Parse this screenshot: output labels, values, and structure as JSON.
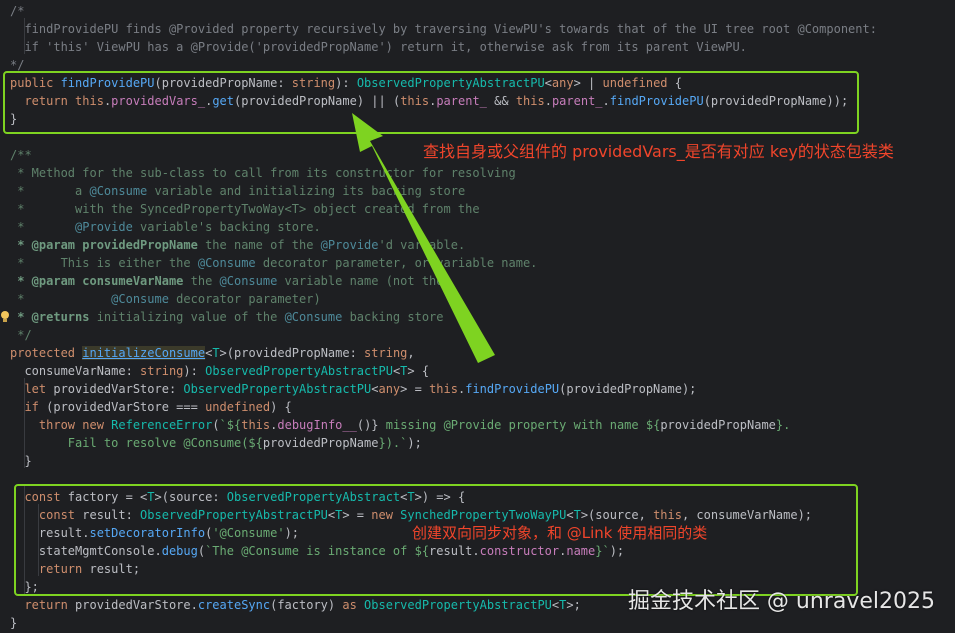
{
  "code": {
    "l1": "/*",
    "l2": "  findProvidePU finds @Provided property recursively by traversing ViewPU's towards that of the UI tree root @Component:",
    "l3": "  if 'this' ViewPU has a @Provide('providedPropName') return it, otherwise ask from its parent ViewPU.",
    "l4": "*/",
    "l5_kw": "public ",
    "l5_fn": "findProvidePU",
    "l5_a": "(providedPropName: ",
    "l5_kw2": "string",
    "l5_b": "): ",
    "l5_type": "ObservedPropertyAbstractPU",
    "l5_c": "<",
    "l5_kw3": "any",
    "l5_d": "> | ",
    "l5_kw4": "undefined",
    "l5_e": " {",
    "l6_kw": "  return ",
    "l6_kw2": "this",
    "l6_a": ".",
    "l6_prop": "providedVars_",
    "l6_b": ".",
    "l6_fn": "get",
    "l6_c": "(providedPropName) || (",
    "l6_kw3": "this",
    "l6_d": ".",
    "l6_prop2": "parent_",
    "l6_e": " && ",
    "l6_kw4": "this",
    "l6_f": ".",
    "l6_prop3": "parent_",
    "l6_g": ".",
    "l6_fn2": "findProvidePU",
    "l6_h": "(providedPropName));",
    "l7": "}",
    "l8": "/**",
    "l9": " * Method for the sub-class to call from its constructor for resolving",
    "l10_a": " *       a ",
    "l10_ref": "@Consume",
    "l10_b": " variable and initializing its backing store",
    "l11": " *       with the SyncedPropertyTwoWay<T> object created from the",
    "l12_a": " *       ",
    "l12_ref": "@Provide",
    "l12_b": " variable's backing store.",
    "l13_tag": " * @param ",
    "l13_p": "providedPropName",
    "l13_a": " the name of the ",
    "l13_ref": "@Provide",
    "l13_b": "'d variable.",
    "l14_a": " *     This is either the ",
    "l14_ref": "@Consume",
    "l14_b": " decorator parameter, or variable name.",
    "l15_tag": " * @param ",
    "l15_p": "consumeVarName",
    "l15_a": " the ",
    "l15_ref": "@Consume",
    "l15_b": " variable name (not the",
    "l16_a": " *            ",
    "l16_ref": "@Consume",
    "l16_b": " decorator parameter)",
    "l17_tag": " * @returns",
    "l17_a": " initializing value of the ",
    "l17_ref": "@Consume",
    "l17_b": " backing store",
    "l18": " */",
    "l19_kw": "protected ",
    "l19_fn": "initializeConsume",
    "l19_a": "<",
    "l19_type": "T",
    "l19_b": ">(providedPropName: ",
    "l19_kw2": "string",
    "l19_c": ",",
    "l20_a": "  consumeVarName: ",
    "l20_kw": "string",
    "l20_b": "): ",
    "l20_type": "ObservedPropertyAbstractPU",
    "l20_c": "<",
    "l20_type2": "T",
    "l20_d": "> {",
    "l21_kw": "  let ",
    "l21_a": "providedVarStore: ",
    "l21_type": "ObservedPropertyAbstractPU",
    "l21_b": "<",
    "l21_kw2": "any",
    "l21_c": "> = ",
    "l21_kw3": "this",
    "l21_d": ".",
    "l21_fn": "findProvidePU",
    "l21_e": "(providedPropName);",
    "l22_kw": "  if ",
    "l22_a": "(providedVarStore === ",
    "l22_kw2": "undefined",
    "l22_b": ") {",
    "l23_kw": "    throw new ",
    "l23_type": "ReferenceError",
    "l23_a": "(",
    "l23_str": "`${",
    "l23_kw2": "this",
    "l23_b": ".",
    "l23_prop": "debugInfo__",
    "l23_c": "()}",
    "l23_str2": " missing @Provide property with name ${",
    "l23_d": "providedPropName",
    "l23_str3": "}.",
    "l24_str": "        Fail to resolve @Consume(${",
    "l24_a": "providedPropName",
    "l24_str2": "}).`",
    "l24_b": ");",
    "l25": "  }",
    "l26_kw": "  const ",
    "l26_a": "factory = <",
    "l26_type": "T",
    "l26_b": ">(source: ",
    "l26_type2": "ObservedPropertyAbstract",
    "l26_c": "<",
    "l26_type3": "T",
    "l26_d": ">) => {",
    "l27_kw": "    const ",
    "l27_a": "result: ",
    "l27_type": "ObservedPropertyAbstractPU",
    "l27_b": "<",
    "l27_type2": "T",
    "l27_c": "> = ",
    "l27_kw2": "new ",
    "l27_type3": "SynchedPropertyTwoWayPU",
    "l27_d": "<",
    "l27_type4": "T",
    "l27_e": ">(source, ",
    "l27_kw3": "this",
    "l27_f": ", consumeVarName);",
    "l28_a": "    result.",
    "l28_fn": "setDecoratorInfo",
    "l28_b": "(",
    "l28_str": "'@Consume'",
    "l28_c": ");",
    "l29_a": "    stateMgmtConsole.",
    "l29_fn": "debug",
    "l29_b": "(",
    "l29_str": "`The @Consume is instance of ${",
    "l29_c": "result.",
    "l29_prop": "constructor",
    "l29_d": ".",
    "l29_prop2": "name",
    "l29_str2": "}`",
    "l29_e": ");",
    "l30_kw": "    return ",
    "l30_a": "result;",
    "l31": "  };",
    "l32_kw": "  return ",
    "l32_a": "providedVarStore.",
    "l32_fn": "createSync",
    "l32_b": "(factory) ",
    "l32_kw2": "as ",
    "l32_type": "ObservedPropertyAbstractPU",
    "l32_c": "<",
    "l32_type2": "T",
    "l32_d": ">;",
    "l33": "}"
  },
  "annotations": {
    "a1": "查找自身或父组件的 providedVars_是否有对应 key的状态包装类",
    "a2": "创建双向同步对象，和 @Link 使用相同的类"
  },
  "watermark": "掘金技术社区 @ unravel2025",
  "colors": {
    "highlight": "#7ed321",
    "annotation": "#f0452b"
  }
}
